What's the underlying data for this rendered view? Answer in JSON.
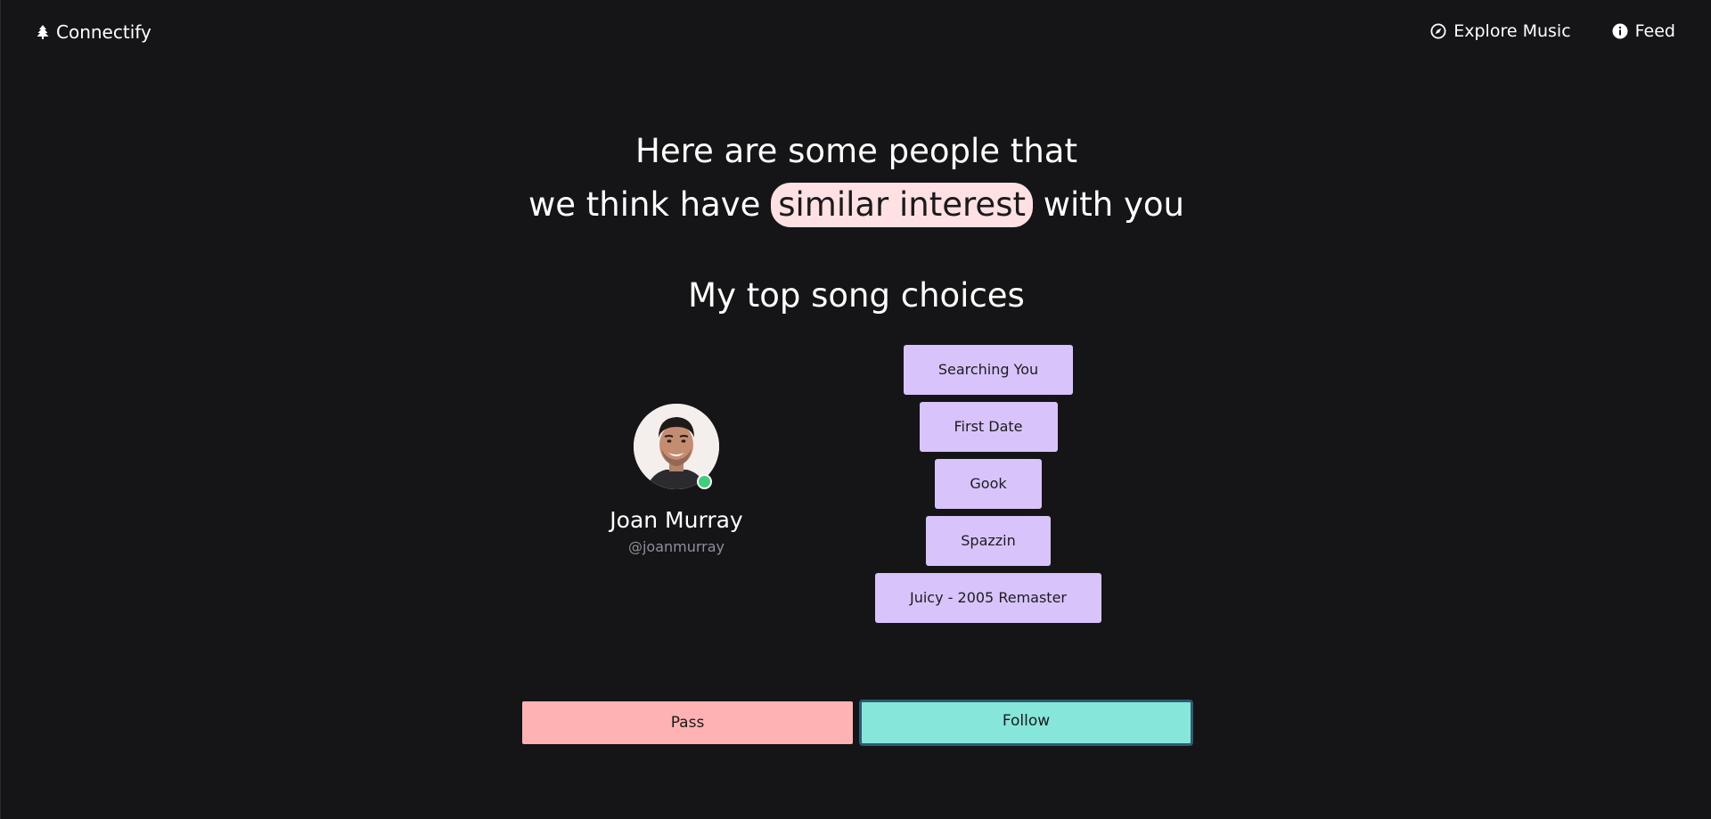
{
  "header": {
    "brand": "Connectify",
    "brand_icon": "tree-icon",
    "nav": [
      {
        "label": "Explore Music",
        "icon": "compass-icon"
      },
      {
        "label": "Feed",
        "icon": "info-icon"
      }
    ]
  },
  "headline": {
    "line1": "Here are some people that",
    "line2_prefix": "we think have",
    "line2_highlight": "similar interest",
    "line2_suffix": "with you"
  },
  "section_title": "My top song choices",
  "profile": {
    "name": "Joan Murray",
    "handle": "@joanmurray",
    "status": "online"
  },
  "songs": [
    "Searching You",
    "First Date",
    "Gook",
    "Spazzin",
    "Juicy - 2005 Remaster"
  ],
  "actions": {
    "pass": "Pass",
    "follow": "Follow"
  },
  "colors": {
    "background": "#151417",
    "highlight": "#ffe0e3",
    "song_chip": "#d8c4fb",
    "pass": "#ffb2b4",
    "follow": "#86e6da",
    "online": "#3fcf7a"
  }
}
